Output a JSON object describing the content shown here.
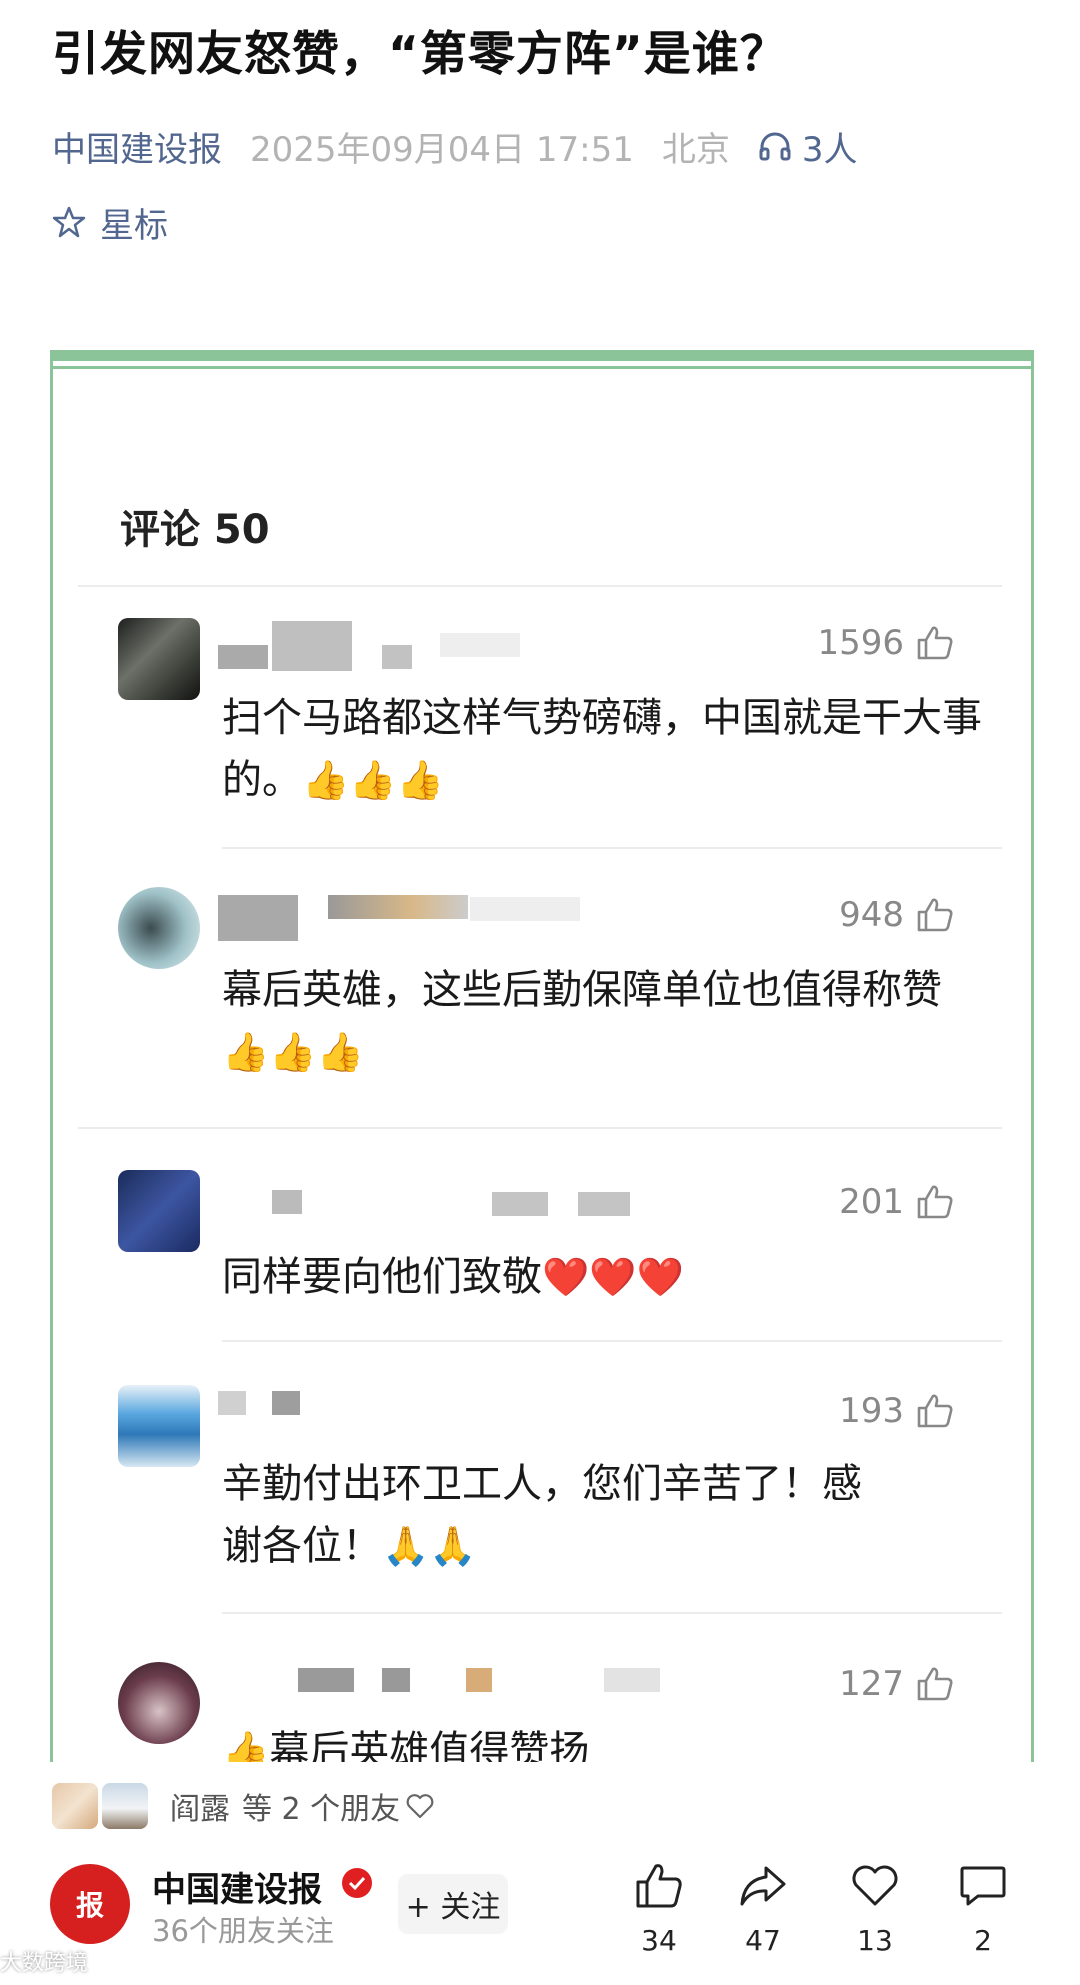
{
  "article": {
    "title": "引发网友怒赞，“第零方阵”是谁？",
    "source": "中国建设报",
    "date": "2025年09月04日 17:51",
    "location": "北京",
    "listeners": "3人",
    "star_label": "星标"
  },
  "comments_section": {
    "header": "评论 50",
    "comments": [
      {
        "likes": "1596",
        "text": "扫个马路都这样气势磅礴，中国就是干大事的。",
        "emoji": "👍👍👍"
      },
      {
        "likes": "948",
        "text": "幕后英雄，这些后勤保障单位也值得称赞",
        "emoji": "👍👍👍"
      },
      {
        "likes": "201",
        "text": "同样要向他们致敬",
        "emoji": "❤️❤️❤️"
      },
      {
        "likes": "193",
        "text": "辛勤付出环卫工人，您们辛苦了！感谢各位！",
        "emoji": "🙏🙏"
      },
      {
        "likes": "127",
        "text": "幕后英雄值得赞扬",
        "emoji": "👍"
      }
    ]
  },
  "friends": {
    "name": "阎露",
    "suffix": "等 2 个朋友"
  },
  "footer": {
    "account_name": "中国建设报",
    "logo_text": "报",
    "friends_following": "36个朋友关注",
    "follow_label": "+ 关注",
    "like_count": "34",
    "share_count": "47",
    "heart_count": "13",
    "comment_count": "2"
  },
  "watermark": "大数跨境",
  "colors": {
    "link": "#52678f",
    "frame": "#8cc49a",
    "brand_red": "#d62020"
  }
}
